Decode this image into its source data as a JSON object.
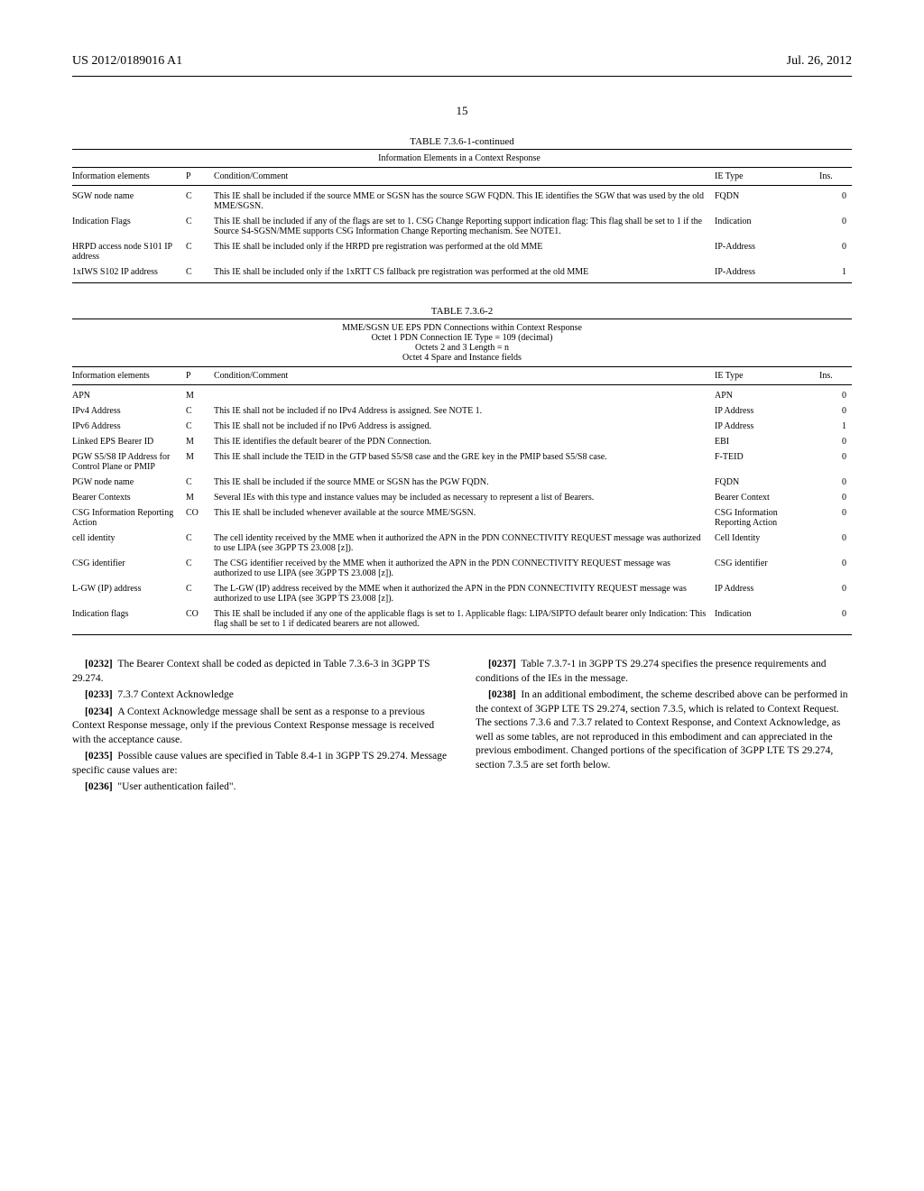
{
  "header": {
    "pub_number": "US 2012/0189016 A1",
    "pub_date": "Jul. 26, 2012",
    "page_number": "15"
  },
  "table1": {
    "title": "TABLE 7.3.6-1-continued",
    "subtitle": "Information Elements in a Context Response",
    "headers": {
      "c1": "Information elements",
      "c2": "P",
      "c3": "Condition/Comment",
      "c4": "IE Type",
      "c5": "Ins."
    },
    "rows": [
      {
        "ie": "SGW node name",
        "p": "C",
        "cond": "This IE shall be included if the source MME or SGSN has the source SGW FQDN. This IE identifies the SGW that was used by the old MME/SGSN.",
        "type": "FQDN",
        "ins": "0"
      },
      {
        "ie": "Indication Flags",
        "p": "C",
        "cond": "This IE shall be included if any of the flags are set to 1. CSG Change Reporting support indication flag: This flag shall be set to 1 if the Source S4-SGSN/MME supports CSG Information Change Reporting mechanism. See NOTE1.",
        "type": "Indication",
        "ins": "0"
      },
      {
        "ie": "HRPD access node S101 IP address",
        "p": "C",
        "cond": "This IE shall be included only if the HRPD pre registration was performed at the old MME",
        "type": "IP-Address",
        "ins": "0"
      },
      {
        "ie": "1xIWS S102 IP address",
        "p": "C",
        "cond": "This IE shall be included only if the 1xRTT CS fallback pre registration was performed at the old MME",
        "type": "IP-Address",
        "ins": "1"
      }
    ]
  },
  "table2": {
    "title": "TABLE 7.3.6-2",
    "subtitle_lines": [
      "MME/SGSN UE EPS PDN Connections within Context Response",
      "Octet 1 PDN Connection IE Type = 109 (decimal)",
      "Octets 2 and 3 Length = n",
      "Octet 4 Spare and Instance fields"
    ],
    "headers": {
      "c1": "Information elements",
      "c2": "P",
      "c3": "Condition/Comment",
      "c4": "IE Type",
      "c5": "Ins."
    },
    "rows": [
      {
        "ie": "APN",
        "p": "M",
        "cond": "",
        "type": "APN",
        "ins": "0"
      },
      {
        "ie": "IPv4 Address",
        "p": "C",
        "cond": "This IE shall not be included if no IPv4 Address is assigned. See NOTE 1.",
        "type": "IP Address",
        "ins": "0"
      },
      {
        "ie": "IPv6 Address",
        "p": "C",
        "cond": "This IE shall not be included if no IPv6 Address is assigned.",
        "type": "IP Address",
        "ins": "1"
      },
      {
        "ie": "Linked EPS Bearer ID",
        "p": "M",
        "cond": "This IE identifies the default bearer of the PDN Connection.",
        "type": "EBI",
        "ins": "0"
      },
      {
        "ie": "PGW S5/S8 IP Address for Control Plane or PMIP",
        "p": "M",
        "cond": "This IE shall include the TEID in the GTP based S5/S8 case and the GRE key in the PMIP based S5/S8 case.",
        "type": "F-TEID",
        "ins": "0"
      },
      {
        "ie": "PGW node name",
        "p": "C",
        "cond": "This IE shall be included if the source MME or SGSN has the PGW FQDN.",
        "type": "FQDN",
        "ins": "0"
      },
      {
        "ie": "Bearer Contexts",
        "p": "M",
        "cond": "Several IEs with this type and instance values may be included as necessary to represent a list of Bearers.",
        "type": "Bearer Context",
        "ins": "0"
      },
      {
        "ie": "CSG Information Reporting Action",
        "p": "CO",
        "cond": "This IE shall be included whenever available at the source MME/SGSN.",
        "type": "CSG Information Reporting Action",
        "ins": "0"
      },
      {
        "ie": "cell identity",
        "p": "C",
        "cond": "The cell identity received by the MME when it authorized the APN in the PDN CONNECTIVITY REQUEST message was authorized to use LIPA (see 3GPP TS 23.008 [z]).",
        "type": "Cell Identity",
        "ins": "0"
      },
      {
        "ie": "CSG identifier",
        "p": "C",
        "cond": "The CSG identifier received by the MME when it authorized the APN in the PDN CONNECTIVITY REQUEST message was authorized to use LIPA (see 3GPP TS 23.008 [z]).",
        "type": "CSG identifier",
        "ins": "0"
      },
      {
        "ie": "L-GW (IP) address",
        "p": "C",
        "cond": "The L-GW (IP) address received by the MME when it authorized the APN in the PDN CONNECTIVITY REQUEST message was authorized to use LIPA (see 3GPP TS 23.008 [z]).",
        "type": "IP Address",
        "ins": "0"
      },
      {
        "ie": "Indication flags",
        "p": "CO",
        "cond": "This IE shall be included if any one of the applicable flags is set to 1. Applicable flags: LIPA/SIPTO default bearer only Indication: This flag shall be set to 1 if dedicated bearers are not allowed.",
        "type": "Indication",
        "ins": "0"
      }
    ]
  },
  "body": {
    "p0232_num": "[0232]",
    "p0232": "The Bearer Context shall be coded as depicted in Table 7.3.6-3 in 3GPP TS 29.274.",
    "p0233_num": "[0233]",
    "p0233": "7.3.7 Context Acknowledge",
    "p0234_num": "[0234]",
    "p0234": "A Context Acknowledge message shall be sent as a response to a previous Context Response message, only if the previous Context Response message is received with the acceptance cause.",
    "p0235_num": "[0235]",
    "p0235": "Possible cause values are specified in Table 8.4-1 in 3GPP TS 29.274. Message specific cause values are:",
    "p0236_num": "[0236]",
    "p0236": "\"User authentication failed\".",
    "p0237_num": "[0237]",
    "p0237": "Table 7.3.7-1 in 3GPP TS 29.274 specifies the presence requirements and conditions of the IEs in the message.",
    "p0238_num": "[0238]",
    "p0238": "In an additional embodiment, the scheme described above can be performed in the context of 3GPP LTE TS 29.274, section 7.3.5, which is related to Context Request. The sections 7.3.6 and 7.3.7 related to Context Response, and Context Acknowledge, as well as some tables, are not reproduced in this embodiment and can appreciated in the previous embodiment. Changed portions of the specification of 3GPP LTE TS 29.274, section 7.3.5 are set forth below."
  }
}
